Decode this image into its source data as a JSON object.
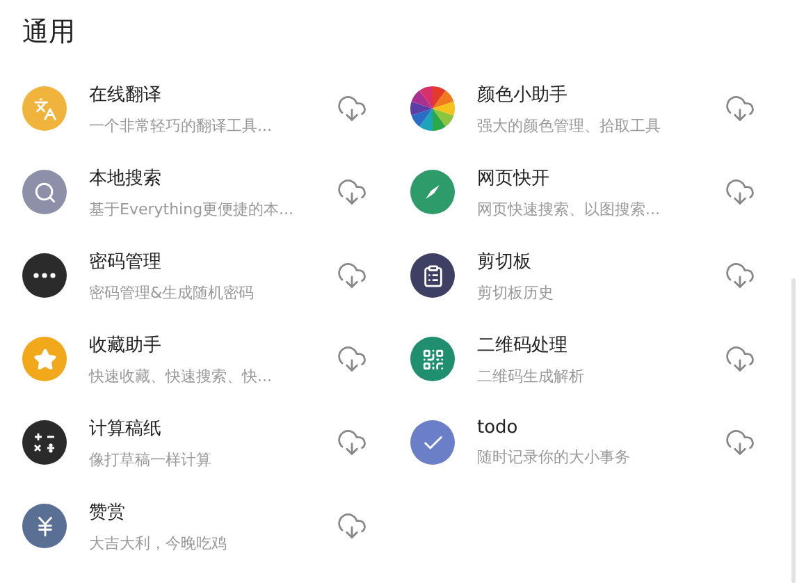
{
  "section": {
    "title": "通用"
  },
  "plugins": [
    {
      "name": "在线翻译",
      "description": "一个非常轻巧的翻译工具...",
      "kind": "translate",
      "color": "#f0b43c"
    },
    {
      "name": "颜色小助手",
      "description": "强大的颜色管理、拾取工具",
      "kind": "colorwheel"
    },
    {
      "name": "本地搜索",
      "description": "基于Everything更便捷的本...",
      "kind": "search",
      "color": "#8e8fa8"
    },
    {
      "name": "网页快开",
      "description": "网页快速搜索、以图搜索...",
      "kind": "compass",
      "color": "#2e9c6a"
    },
    {
      "name": "密码管理",
      "description": "密码管理&生成随机密码",
      "kind": "password",
      "color": "#2b2b2b"
    },
    {
      "name": "剪切板",
      "description": "剪切板历史",
      "kind": "clipboard",
      "color": "#3d3f63"
    },
    {
      "name": "收藏助手",
      "description": "快速收藏、快速搜索、快...",
      "kind": "star",
      "color": "#f1a81a"
    },
    {
      "name": "二维码处理",
      "description": "二维码生成解析",
      "kind": "qrcode",
      "color": "#1f8f6f"
    },
    {
      "name": "计算稿纸",
      "description": "像打草稿一样计算",
      "kind": "calculator",
      "color": "#2a2a2a"
    },
    {
      "name": "todo",
      "description": "随时记录你的大小事务",
      "kind": "check",
      "color": "#6a7fc8"
    },
    {
      "name": "赞赏",
      "description": "大吉大利，今晚吃鸡",
      "kind": "yen",
      "color": "#5a6f94"
    }
  ]
}
